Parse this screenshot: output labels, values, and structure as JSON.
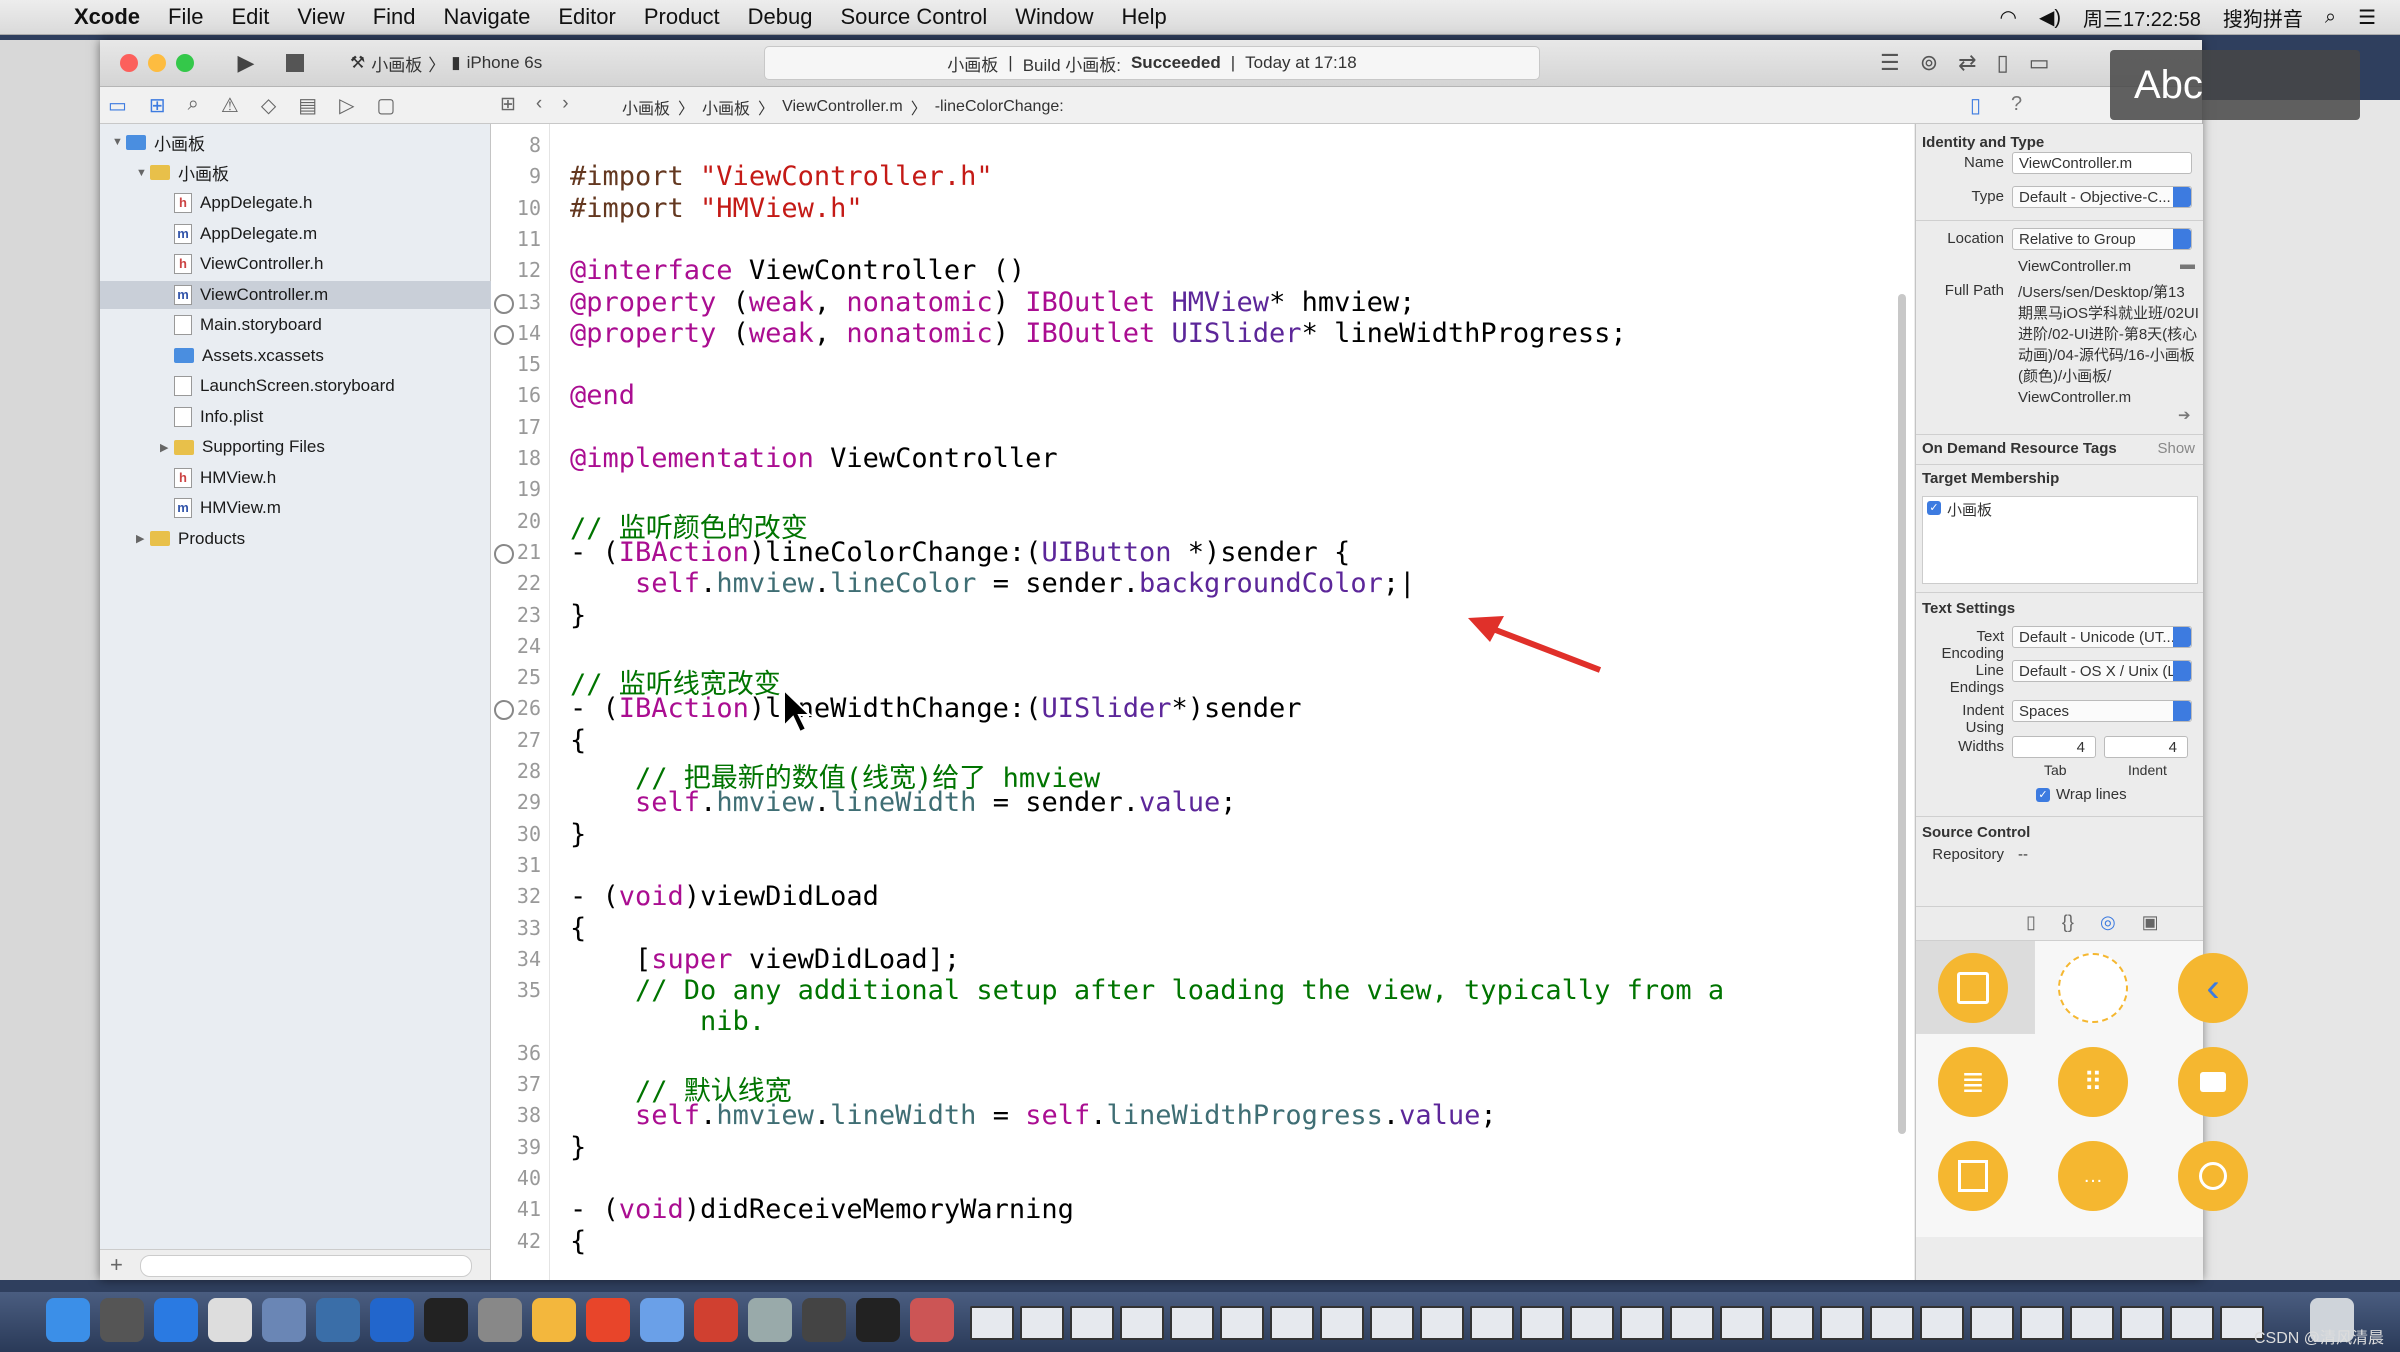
{
  "menubar": {
    "app": "Xcode",
    "items": [
      "File",
      "Edit",
      "View",
      "Find",
      "Navigate",
      "Editor",
      "Product",
      "Debug",
      "Source Control",
      "Window",
      "Help"
    ],
    "clock": "周三17:22:58",
    "ime": "搜狗拼音"
  },
  "toolbar": {
    "scheme": "小画板",
    "device": "iPhone 6s",
    "status_project": "小画板",
    "status_build": "Build 小画板:",
    "status_result": "Succeeded",
    "status_time": "Today at 17:18"
  },
  "jumpbar": {
    "crumbs": [
      "小画板",
      "小画板",
      "ViewController.m",
      "-lineColorChange:"
    ]
  },
  "navigator": {
    "items": [
      {
        "label": "小画板",
        "kind": "project",
        "indent": 0,
        "selected": false
      },
      {
        "label": "小画板",
        "kind": "folder",
        "indent": 1,
        "selected": false
      },
      {
        "label": "AppDelegate.h",
        "kind": "h",
        "indent": 2,
        "selected": false
      },
      {
        "label": "AppDelegate.m",
        "kind": "m",
        "indent": 2,
        "selected": false
      },
      {
        "label": "ViewController.h",
        "kind": "h",
        "indent": 2,
        "selected": false
      },
      {
        "label": "ViewController.m",
        "kind": "m",
        "indent": 2,
        "selected": true
      },
      {
        "label": "Main.storyboard",
        "kind": "sb",
        "indent": 2,
        "selected": false
      },
      {
        "label": "Assets.xcassets",
        "kind": "assets",
        "indent": 2,
        "selected": false
      },
      {
        "label": "LaunchScreen.storyboard",
        "kind": "sb",
        "indent": 2,
        "selected": false
      },
      {
        "label": "Info.plist",
        "kind": "plist",
        "indent": 2,
        "selected": false
      },
      {
        "label": "Supporting Files",
        "kind": "folder",
        "indent": 2,
        "selected": false
      },
      {
        "label": "HMView.h",
        "kind": "h",
        "indent": 2,
        "selected": false
      },
      {
        "label": "HMView.m",
        "kind": "m",
        "indent": 2,
        "selected": false
      },
      {
        "label": "Products",
        "kind": "folder",
        "indent": 1,
        "selected": false
      }
    ]
  },
  "editor": {
    "lines": [
      {
        "n": "8",
        "bp": false,
        "html": ""
      },
      {
        "n": "9",
        "bp": false,
        "html": "<span class='pp'>#import </span><span class='str'>\"ViewController.h\"</span>"
      },
      {
        "n": "10",
        "bp": false,
        "html": "<span class='pp'>#import </span><span class='str'>\"HMView.h\"</span>"
      },
      {
        "n": "11",
        "bp": false,
        "html": ""
      },
      {
        "n": "12",
        "bp": false,
        "html": "<span class='kw'>@interface</span> ViewController ()"
      },
      {
        "n": "13",
        "bp": true,
        "html": "<span class='kw'>@property</span> (<span class='kw'>weak</span>, <span class='kw'>nonatomic</span>) <span class='kw'>IBOutlet</span> <span class='ty'>HMView</span>* hmview;"
      },
      {
        "n": "14",
        "bp": true,
        "html": "<span class='kw'>@property</span> (<span class='kw'>weak</span>, <span class='kw'>nonatomic</span>) <span class='kw'>IBOutlet</span> <span class='ty'>UISlider</span>* lineWidthProgress;"
      },
      {
        "n": "15",
        "bp": false,
        "html": ""
      },
      {
        "n": "16",
        "bp": false,
        "html": "<span class='kw'>@end</span>"
      },
      {
        "n": "17",
        "bp": false,
        "html": ""
      },
      {
        "n": "18",
        "bp": false,
        "html": "<span class='kw'>@implementation</span> ViewController"
      },
      {
        "n": "19",
        "bp": false,
        "html": ""
      },
      {
        "n": "20",
        "bp": false,
        "html": "<span class='cm'>// 监听颜色的改变</span>"
      },
      {
        "n": "21",
        "bp": true,
        "html": "- (<span class='kw'>IBAction</span>)lineColorChange:(<span class='ty'>UIButton</span> *)sender {"
      },
      {
        "n": "22",
        "bp": false,
        "html": "    <span class='kw'>self</span>.<span class='pr'>hmview</span>.<span class='pr'>lineColor</span> = sender.<span class='ty'>backgroundColor</span>;|"
      },
      {
        "n": "23",
        "bp": false,
        "html": "}"
      },
      {
        "n": "24",
        "bp": false,
        "html": ""
      },
      {
        "n": "25",
        "bp": false,
        "html": "<span class='cm'>// 监听线宽改变</span>"
      },
      {
        "n": "26",
        "bp": true,
        "html": "- (<span class='kw'>IBAction</span>)lineWidthChange:(<span class='ty'>UISlider</span>*)sender"
      },
      {
        "n": "27",
        "bp": false,
        "html": "{"
      },
      {
        "n": "28",
        "bp": false,
        "html": "    <span class='cm'>// 把最新的数值(线宽)给了 hmview</span>"
      },
      {
        "n": "29",
        "bp": false,
        "html": "    <span class='kw'>self</span>.<span class='pr'>hmview</span>.<span class='pr'>lineWidth</span> = sender.<span class='ty'>value</span>;"
      },
      {
        "n": "30",
        "bp": false,
        "html": "}"
      },
      {
        "n": "31",
        "bp": false,
        "html": ""
      },
      {
        "n": "32",
        "bp": false,
        "html": "- (<span class='kw'>void</span>)viewDidLoad"
      },
      {
        "n": "33",
        "bp": false,
        "html": "{"
      },
      {
        "n": "34",
        "bp": false,
        "html": "    [<span class='kw'>super</span> viewDidLoad];"
      },
      {
        "n": "35",
        "bp": false,
        "html": "    <span class='cm'>// Do any additional setup after loading the view, typically from a</span>"
      },
      {
        "n": "",
        "bp": false,
        "html": "        <span class='cm'>nib.</span>"
      },
      {
        "n": "36",
        "bp": false,
        "html": ""
      },
      {
        "n": "37",
        "bp": false,
        "html": "    <span class='cm'>// 默认线宽</span>"
      },
      {
        "n": "38",
        "bp": false,
        "html": "    <span class='kw'>self</span>.<span class='pr'>hmview</span>.<span class='pr'>lineWidth</span> = <span class='kw'>self</span>.<span class='pr'>lineWidthProgress</span>.<span class='ty'>value</span>;"
      },
      {
        "n": "39",
        "bp": false,
        "html": "}"
      },
      {
        "n": "40",
        "bp": false,
        "html": ""
      },
      {
        "n": "41",
        "bp": false,
        "html": "- (<span class='kw'>void</span>)didReceiveMemoryWarning"
      },
      {
        "n": "42",
        "bp": false,
        "html": "{"
      }
    ]
  },
  "inspector": {
    "identity_header": "Identity and Type",
    "name_label": "Name",
    "name_value": "ViewController.m",
    "type_label": "Type",
    "type_value": "Default - Objective-C...",
    "location_label": "Location",
    "location_value": "Relative to Group",
    "location_file": "ViewController.m",
    "fullpath_label": "Full Path",
    "fullpath_lines": [
      "/Users/sen/Desktop/第13",
      "期黑马iOS学科就业班/02UI",
      "进阶/02-UI进阶-第8天(核心",
      "动画)/04-源代码/16-小画板",
      "(颜色)/小画板/",
      "ViewController.m"
    ],
    "ondemand_header": "On Demand Resource Tags",
    "ondemand_show": "Show",
    "target_header": "Target Membership",
    "target_item": "小画板",
    "text_header": "Text Settings",
    "encoding_label": "Text Encoding",
    "encoding_value": "Default - Unicode (UT...",
    "endings_label": "Line Endings",
    "endings_value": "Default - OS X / Unix (LF)",
    "indent_label": "Indent Using",
    "indent_value": "Spaces",
    "widths_label": "Widths",
    "tab_value": "4",
    "indent_width_value": "4",
    "tab_caption": "Tab",
    "indent_caption": "Indent",
    "wrap_label": "Wrap lines",
    "sc_header": "Source Control",
    "repo_label": "Repository",
    "repo_value": "--"
  },
  "overlay": {
    "abc": "Abc",
    "watermark": "CSDN @清风清晨"
  }
}
